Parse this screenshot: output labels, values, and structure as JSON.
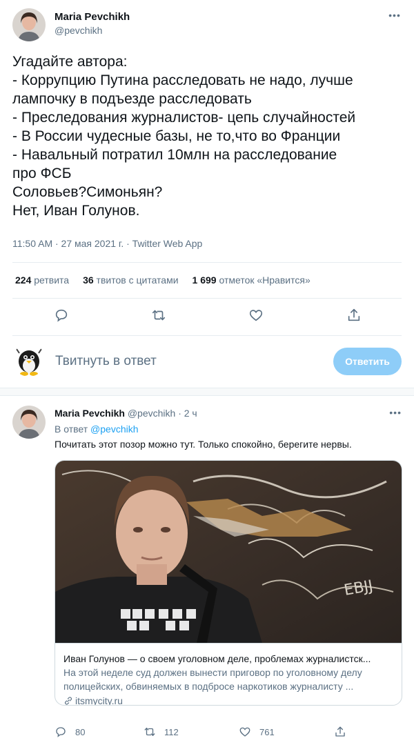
{
  "main_tweet": {
    "author_name": "Maria Pevchikh",
    "author_handle": "@pevchikh",
    "more_icon": "more-horizontal-icon",
    "text_lines": [
      "Угадайте автора:",
      "- Коррупцию Путина расследовать не надо, лучше",
      "лампочку в подъезде расследовать",
      "- Преследования журналистов- цепь случайностей",
      "- В России чудесные базы, не то,что во Франции",
      "- Навальный потратил 10млн на расследование",
      "про ФСБ",
      "Соловьев?Симоньян?",
      "Нет, Иван Голунов."
    ],
    "meta": "11:50 AM · 27 мая 2021 г. · Twitter Web App",
    "stats": {
      "retweets_count": "224",
      "retweets_label": "ретвита",
      "quotes_count": "36",
      "quotes_label": "твитов с цитатами",
      "likes_count": "1 699",
      "likes_label": "отметок «Нравится»"
    },
    "actions": [
      "reply-icon",
      "retweet-icon",
      "like-icon",
      "share-icon"
    ]
  },
  "reply_composer": {
    "placeholder": "Твитнуть в ответ",
    "button_label": "Ответить"
  },
  "reply_tweet": {
    "author_name": "Maria Pevchikh",
    "author_handle": "@pevchikh",
    "time": "· 2 ч",
    "in_reply_prefix": "В ответ",
    "in_reply_mention": "@pevchikh",
    "text": "Почитать этот позор можно тут. Только спокойно, берегите нервы.",
    "card": {
      "title": "Иван Голунов — о своем уголовном деле, проблемах журналистск...",
      "description_lines": [
        "На этой неделе суд должен вынести приговор по уголовному делу",
        "полицейских, обвиняемых в подбросе наркотиков журналисту ..."
      ],
      "domain": "itsmycity.ru"
    },
    "actions": {
      "replies": "80",
      "retweets": "112",
      "likes": "761"
    }
  },
  "colors": {
    "accent": "#1da1f2",
    "secondary_text": "#5b7083",
    "button_disabled": "#8ecdf8",
    "divider": "#e6ecf0"
  }
}
